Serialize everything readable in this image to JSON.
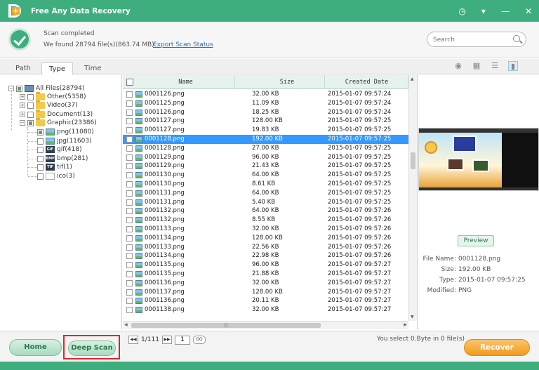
{
  "app": {
    "title": "Free Any Data Recovery"
  },
  "window_controls": {
    "icons": [
      "history-icon",
      "dropdown-icon",
      "minimize-icon",
      "close-icon"
    ]
  },
  "status": {
    "title": "Scan completed",
    "found": "We found 28794 file(s)(863.74 MB).",
    "export_link": "Export Scan Status"
  },
  "search": {
    "placeholder": "Search",
    "value": ""
  },
  "tabs": [
    {
      "label": "Path",
      "active": false
    },
    {
      "label": "Type",
      "active": true
    },
    {
      "label": "Time",
      "active": false
    }
  ],
  "view_modes": [
    "eye-icon",
    "grid-icon",
    "list-icon",
    "detail-icon"
  ],
  "tree": {
    "root": "All Files(28794)",
    "items": [
      {
        "label": "Other(5358)"
      },
      {
        "label": "Video(37)"
      },
      {
        "label": "Document(13)"
      },
      {
        "label": "Graphic(23386)"
      }
    ],
    "graphic_children": [
      {
        "label": "png(11080)",
        "icon": "png-icon"
      },
      {
        "label": "jpg(11603)",
        "icon": "jpg-icon"
      },
      {
        "label": "gif(418)",
        "icon": "gif-icon",
        "tag": "GIF"
      },
      {
        "label": "bmp(281)",
        "icon": "bmp-icon",
        "tag": "BMP"
      },
      {
        "label": "tif(1)",
        "icon": "tif-icon",
        "tag": "TIF"
      },
      {
        "label": "ico(3)",
        "icon": "ico-icon"
      }
    ]
  },
  "table": {
    "headers": [
      "Name",
      "Size",
      "Created Date"
    ],
    "rows": [
      [
        "0001126.png",
        "32.00 KB",
        "2015-01-07 09:57:24"
      ],
      [
        "0001125.png",
        "11.09 KB",
        "2015-01-07 09:57:24"
      ],
      [
        "0001126.png",
        "18.25 KB",
        "2015-01-07 09:57:24"
      ],
      [
        "0001127.png",
        "128.00 KB",
        "2015-01-07 09:57:25"
      ],
      [
        "0001127.png",
        "19.83 KB",
        "2015-01-07 09:57:25"
      ],
      [
        "0001128.png",
        "192.00 KB",
        "2015-01-07 09:57:25"
      ],
      [
        "0001128.png",
        "27.00 KB",
        "2015-01-07 09:57:25"
      ],
      [
        "0001129.png",
        "96.00 KB",
        "2015-01-07 09:57:25"
      ],
      [
        "0001129.png",
        "21.43 KB",
        "2015-01-07 09:57:25"
      ],
      [
        "0001130.png",
        "64.00 KB",
        "2015-01-07 09:57:25"
      ],
      [
        "0001130.png",
        "8.61 KB",
        "2015-01-07 09:57:25"
      ],
      [
        "0001131.png",
        "64.00 KB",
        "2015-01-07 09:57:25"
      ],
      [
        "0001131.png",
        "5.40 KB",
        "2015-01-07 09:57:25"
      ],
      [
        "0001132.png",
        "64.00 KB",
        "2015-01-07 09:57:26"
      ],
      [
        "0001132.png",
        "8.55 KB",
        "2015-01-07 09:57:26"
      ],
      [
        "0001133.png",
        "32.00 KB",
        "2015-01-07 09:57:26"
      ],
      [
        "0001134.png",
        "128.00 KB",
        "2015-01-07 09:57:26"
      ],
      [
        "0001133.png",
        "22.56 KB",
        "2015-01-07 09:57:26"
      ],
      [
        "0001134.png",
        "22.98 KB",
        "2015-01-07 09:57:26"
      ],
      [
        "0001135.png",
        "96.00 KB",
        "2015-01-07 09:57:27"
      ],
      [
        "0001135.png",
        "21.88 KB",
        "2015-01-07 09:57:27"
      ],
      [
        "0001136.png",
        "32.00 KB",
        "2015-01-07 09:57:27"
      ],
      [
        "0001137.png",
        "128.00 KB",
        "2015-01-07 09:57:27"
      ],
      [
        "0001136.png",
        "20.11 KB",
        "2015-01-07 09:57:27"
      ],
      [
        "0001138.png",
        "32.00 KB",
        "2015-01-07 09:57:27"
      ]
    ],
    "selected_row": 5
  },
  "preview": {
    "button": "Preview",
    "labels": {
      "name": "File Name:",
      "size": "Size:",
      "type": "Type:",
      "modified": "Modified:"
    },
    "values": {
      "name": "0001128.png",
      "size": "192.00 KB",
      "type": "2015-01-07 09:57:25",
      "modified": "PNG"
    }
  },
  "bottom": {
    "home": "Home",
    "deep_scan": "Deep Scan",
    "page_info": "1/111",
    "page_value": "1",
    "go": "GO",
    "selection": "You select 0.Byte in 0 file(s)",
    "recover": "Recover"
  },
  "colors": {
    "accent": "#3fae7f",
    "selection": "#3399ff",
    "recover": "#f29a1d",
    "highlight_box": "#d42a2a"
  }
}
